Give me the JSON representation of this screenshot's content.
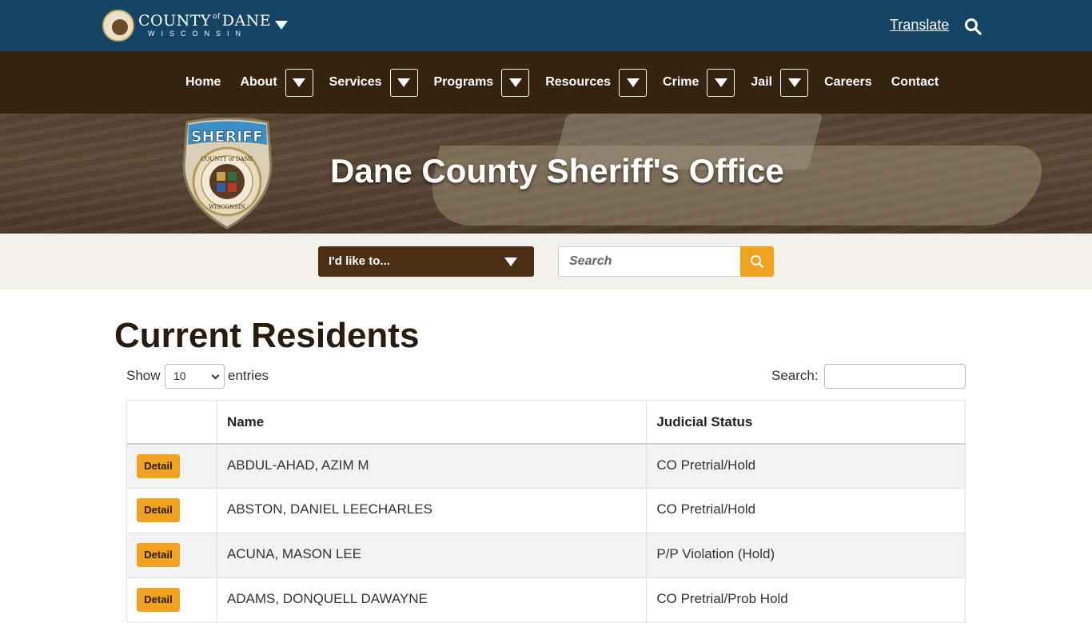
{
  "header": {
    "brand_line1": "COUNTY",
    "brand_of": "of",
    "brand_line1b": "DANE",
    "brand_line2": "WISCONSIN",
    "translate": "Translate"
  },
  "nav": {
    "items": [
      {
        "label": "Home"
      },
      {
        "label": "About"
      },
      {
        "label": "Services"
      },
      {
        "label": "Programs"
      },
      {
        "label": "Resources"
      },
      {
        "label": "Crime"
      },
      {
        "label": "Jail"
      },
      {
        "label": "Careers"
      },
      {
        "label": "Contact"
      }
    ]
  },
  "banner": {
    "title": "Dane County Sheriff's Office",
    "badge_top": "SHERIFF",
    "badge_ring": "COUNTY of DANE",
    "badge_bottom": "WISCONSIN"
  },
  "actions": {
    "i_like_to": "I'd like to...",
    "search_placeholder": "Search"
  },
  "page": {
    "title": "Current Residents",
    "show_label": "Show",
    "entries_value": "10",
    "entries_label": "entries",
    "search_label": "Search:"
  },
  "table": {
    "headers": [
      "",
      "Name",
      "Judicial Status"
    ],
    "detail_label": "Detail",
    "rows": [
      {
        "name": "ABDUL-AHAD, AZIM M",
        "status": "CO Pretrial/Hold"
      },
      {
        "name": "ABSTON, DANIEL LEECHARLES",
        "status": "CO Pretrial/Hold"
      },
      {
        "name": "ACUNA, MASON LEE",
        "status": "P/P Violation (Hold)"
      },
      {
        "name": "ADAMS, DONQUELL DAWAYNE",
        "status": "CO Pretrial/Prob Hold"
      }
    ]
  },
  "colors": {
    "top_bar": "#144363",
    "nav_bar": "#33230f",
    "accent": "#f0a21f",
    "dropdown": "#4b2f14"
  }
}
